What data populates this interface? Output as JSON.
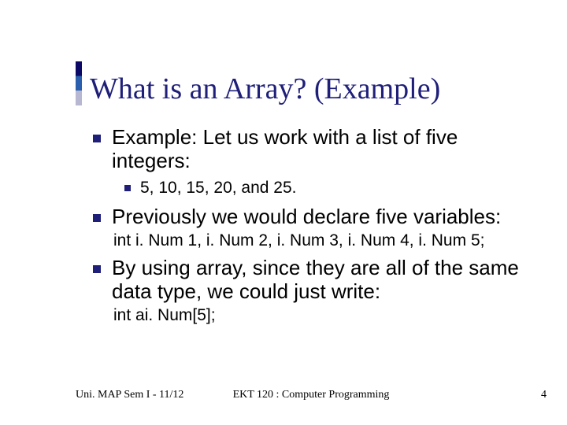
{
  "title": "What is an Array? (Example)",
  "bullets": {
    "b1": "Example: Let us work with a list of five integers:",
    "b1_sub": "5, 10, 15, 20, and 25.",
    "b2": "Previously we would declare five variables:",
    "b2_code": "int i. Num 1, i. Num 2, i. Num 3, i. Num 4, i. Num 5;",
    "b3": "By using array, since they are all of the same data type, we could just write:",
    "b3_code": "int ai. Num[5];"
  },
  "footer": {
    "left": "Uni. MAP Sem I -  11/12",
    "center": "EKT 120 : Computer Programming",
    "right": "4"
  }
}
